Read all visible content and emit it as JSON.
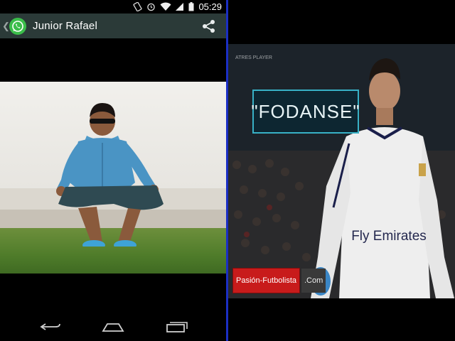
{
  "status_bar": {
    "time": "05:29",
    "icons": [
      "rotate-icon",
      "alarm-icon",
      "wifi-icon",
      "signal-icon",
      "battery-icon"
    ]
  },
  "app_bar": {
    "contact_name": "Junior Rafael",
    "logo": "whatsapp-icon",
    "action": "share-icon",
    "background": "#2b3a38"
  },
  "nav_bar": {
    "buttons": [
      "back-icon",
      "home-icon",
      "recent-apps-icon"
    ]
  },
  "video": {
    "broadcaster_logo": "ATRES PLAYER",
    "caption": "\"FODANSE\"",
    "jersey_text": "Fly Emirates",
    "watermark_left": "Pasión-Futbolista",
    "watermark_right": ".Com",
    "caption_border_color": "#38b1c6",
    "watermark_color": "#c81b1b"
  },
  "divider_color": "#1b2fc4"
}
